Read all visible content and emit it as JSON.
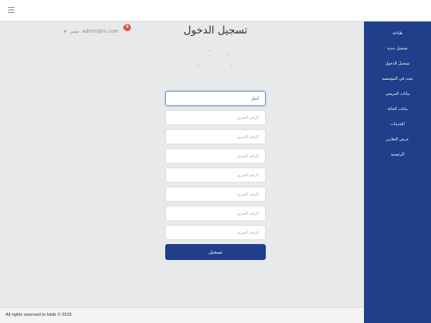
{
  "topbar": {
    "menu_icon": "hamburger-icon"
  },
  "header": {
    "email": "admin@m.com",
    "user_caption": "نسي",
    "notification_count": "5",
    "chevron_icon": "chevron-down-icon"
  },
  "page": {
    "title": "تسجيل الدخول"
  },
  "form": {
    "first_field_value": "اسل",
    "placeholder": "الرقم السري",
    "fields": [
      "الرقم السري",
      "الرقم السري",
      "الرقم السري",
      "الرقم السري",
      "الرقم السري",
      "الرقم السري",
      "الرقم السري"
    ],
    "submit_label": "تسجيل"
  },
  "sidebar": {
    "items": [
      {
        "label": "طباعة"
      },
      {
        "label": "تسجيل جديد"
      },
      {
        "label": "تسجيل الدخول"
      },
      {
        "label": "بحث في المؤسسة"
      },
      {
        "label": "بيانات المرضى"
      },
      {
        "label": "بيانات الحالة"
      },
      {
        "label": "الخدمات"
      },
      {
        "label": "عرض التقارير"
      },
      {
        "label": "الرئيسية"
      }
    ]
  },
  "footer": {
    "text": "All rights reserved to Islah © 2018"
  },
  "colors": {
    "primary": "#1f3f8a",
    "badge": "#e84545",
    "background": "#e8e9eb"
  }
}
